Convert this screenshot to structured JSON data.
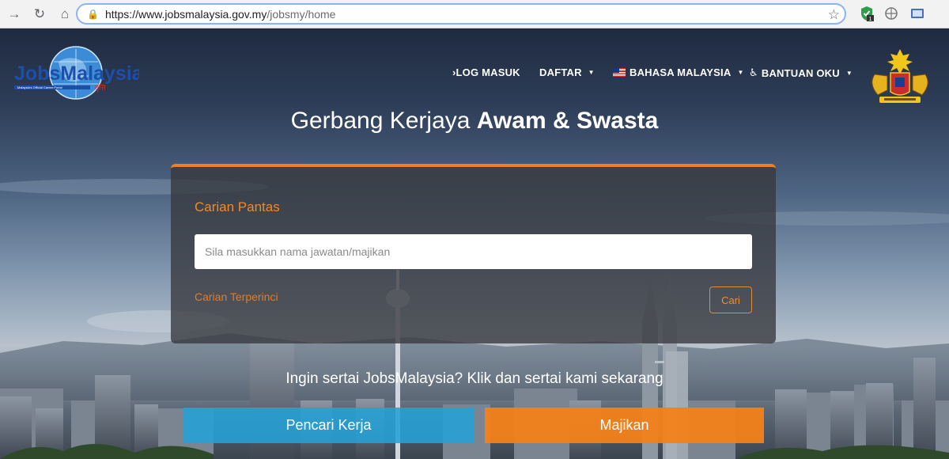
{
  "browser": {
    "url_domain": "https://www.jobsmalaysia.gov.my",
    "url_path": "/jobsmy/home",
    "extension_badge": "1"
  },
  "header": {
    "logo_text": "JobsMalaysia.",
    "logo_tagline": "Malaysia's Official Career Portal",
    "nav": {
      "login": "LOG MASUK",
      "register": "DAFTAR",
      "language": "BAHASA MALAYSIA",
      "accessibility": "BANTUAN OKU"
    }
  },
  "hero": {
    "headline_light": "Gerbang Kerjaya ",
    "headline_bold": "Awam & Swasta"
  },
  "search": {
    "title": "Carian Pantas",
    "placeholder": "Sila masukkan nama jawatan/majikan",
    "advanced_link": "Carian Terperinci",
    "submit_label": "Cari"
  },
  "join": {
    "text": "Ingin sertai JobsMalaysia? Klik dan sertai kami sekarang"
  },
  "cta": {
    "job_seeker": "Pencari Kerja",
    "employer": "Majikan"
  },
  "colors": {
    "accent_orange": "#f07f1e",
    "seeker_blue": "#26a0d7",
    "panel": "#37393e"
  }
}
